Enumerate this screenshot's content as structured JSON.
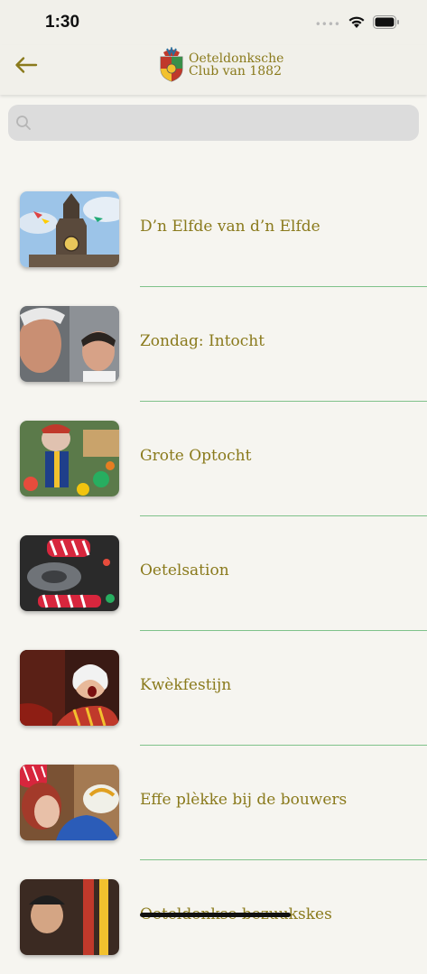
{
  "status_bar": {
    "time": "1:30",
    "signal_dots": "••••"
  },
  "nav": {
    "logo_line1": "Oeteldonksche",
    "logo_line2": "Club van 1882"
  },
  "search": {
    "placeholder": ""
  },
  "items": [
    {
      "label": "D’n Elfde van d’n Elfde"
    },
    {
      "label": "Zondag: Intocht"
    },
    {
      "label": "Grote Optocht"
    },
    {
      "label": "Oetelsation"
    },
    {
      "label": "Kwèkfestijn"
    },
    {
      "label": "Effe plèkke bij de bouwers"
    },
    {
      "label": "Oeteldonkse bezuukskes"
    }
  ],
  "colors": {
    "accent": "#8a7a1c",
    "divider": "#7fc28a",
    "background": "#f6f5f0"
  }
}
